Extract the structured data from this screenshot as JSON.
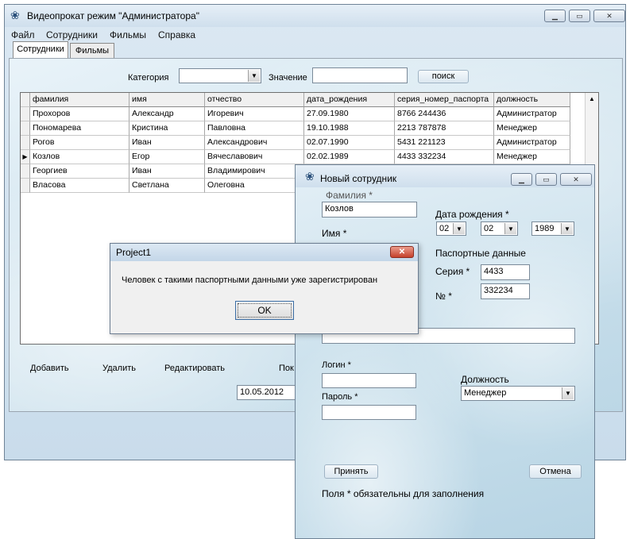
{
  "main": {
    "title": "Видеопрокат режим \"Администратора\"",
    "menu": [
      "Файл",
      "Сотрудники",
      "Фильмы",
      "Справка"
    ],
    "tabs": [
      "Сотрудники",
      "Фильмы"
    ],
    "category_label": "Категория",
    "category_value": "",
    "value_label": "Значение",
    "value_input": "",
    "search_button": "поиск",
    "grid": {
      "columns": [
        "фамилия",
        "имя",
        "отчество",
        "дата_рождения",
        "серия_номер_паспорта",
        "должность"
      ],
      "rows": [
        [
          "Прохоров",
          "Александр",
          "Игоревич",
          "27.09.1980",
          "8766 244436",
          "Администратор"
        ],
        [
          "Пономарева",
          "Кристина",
          "Павловна",
          "19.10.1988",
          "2213 787878",
          "Менеджер"
        ],
        [
          "Рогов",
          "Иван",
          "Александрович",
          "02.07.1990",
          "5431 221123",
          "Администратор"
        ],
        [
          "Козлов",
          "Егор",
          "Вячеславович",
          "02.02.1989",
          "4433 332234",
          "Менеджер"
        ],
        [
          "Георгиев",
          "Иван",
          "Владимирович",
          "",
          "",
          ""
        ],
        [
          "Власова",
          "Светлана",
          "Олеговна",
          "",
          "",
          ""
        ]
      ],
      "current_row_marker": "▶"
    },
    "buttons": {
      "add": "Добавить",
      "delete": "Удалить",
      "edit": "Редактировать",
      "search_partial": "Пок"
    },
    "date_value": "10.05.2012"
  },
  "new_employee": {
    "title": "Новый сотрудник",
    "surname_label": "Фамилия *",
    "surname_value": "Козлов",
    "name_label": "Имя *",
    "birth_label": "Дата рождения *",
    "birth_day": "02",
    "birth_month": "02",
    "birth_year": "1989",
    "passport_label": "Паспортные данные",
    "series_label": "Серия *",
    "series_value": "4433",
    "number_label": "№ *",
    "number_value": "332234",
    "login_label": "Логин *",
    "password_label": "Пароль *",
    "position_label": "Должность",
    "position_value": "Менеджер",
    "accept_button": "Принять",
    "cancel_button": "Отмена",
    "required_note": "Поля * обязательны для заполнения"
  },
  "message_box": {
    "title": "Project1",
    "message": "Человек с такими паспортными данными уже зарегистрирован",
    "ok_button": "OK",
    "close_glyph": "✕"
  },
  "icons": {
    "app": "app-icon",
    "minimize": "minimize-icon",
    "maximize": "maximize-icon",
    "close": "close-icon"
  }
}
